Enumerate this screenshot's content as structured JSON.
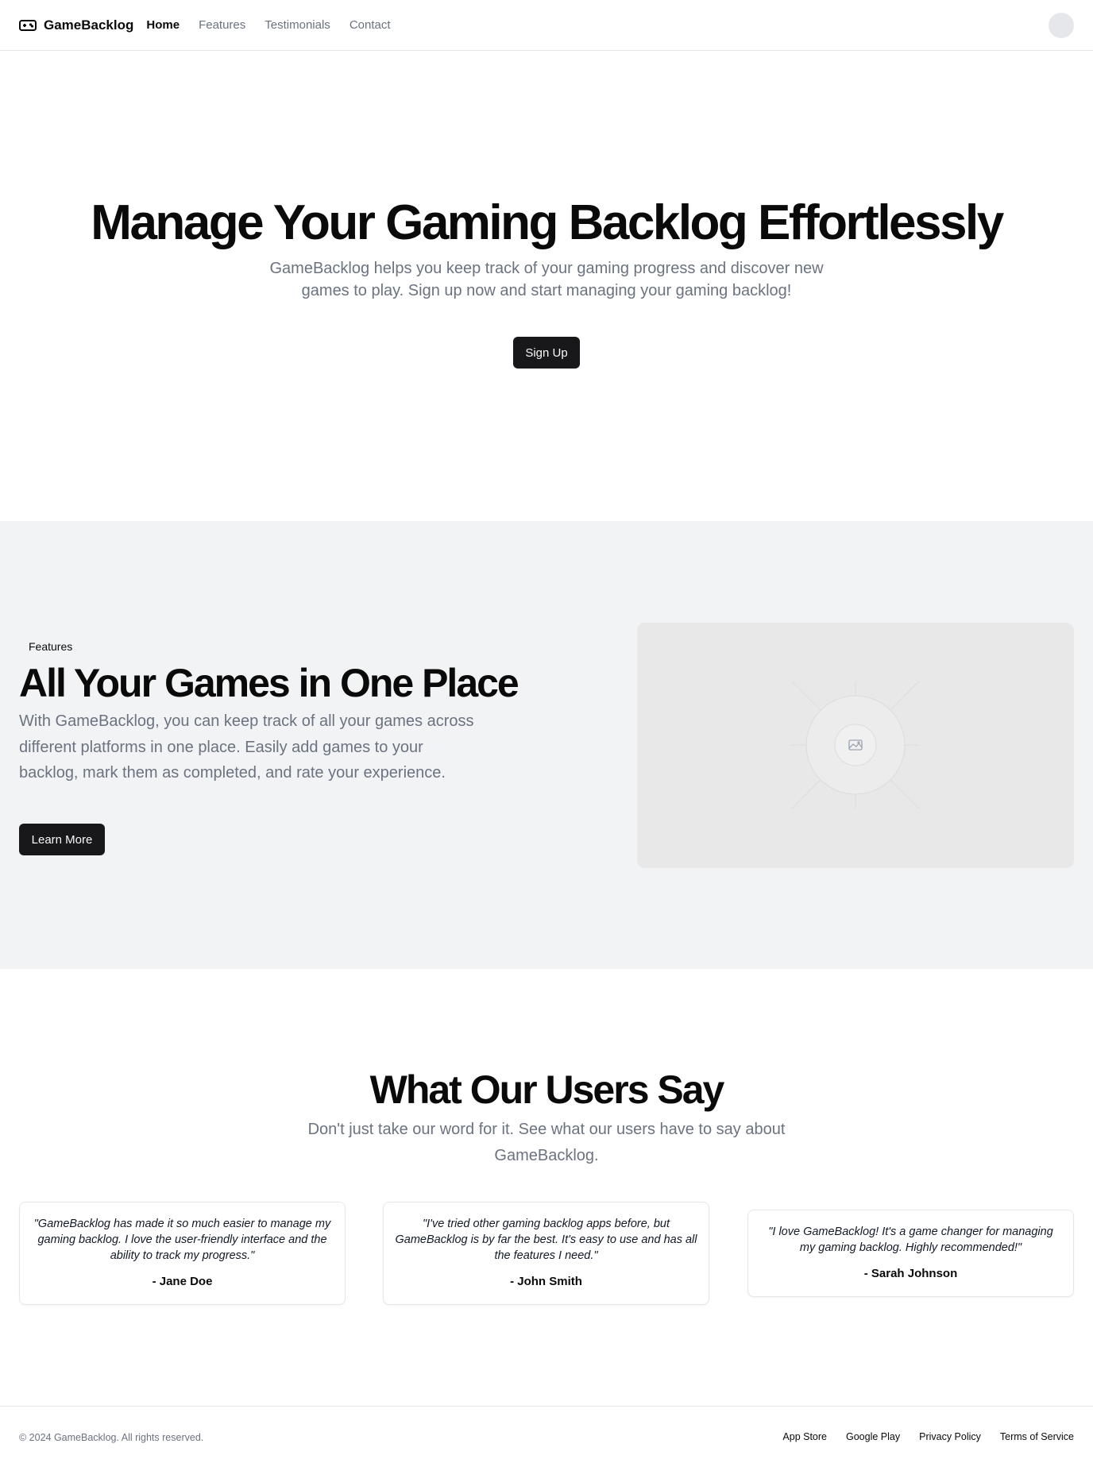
{
  "header": {
    "brand": "GameBacklog",
    "brand_icon": "gamepad-icon",
    "nav": [
      {
        "label": "Home",
        "active": true
      },
      {
        "label": "Features",
        "active": false
      },
      {
        "label": "Testimonials",
        "active": false
      },
      {
        "label": "Contact",
        "active": false
      }
    ]
  },
  "hero": {
    "title": "Manage Your Gaming Backlog Effortlessly",
    "description": "GameBacklog helps you keep track of your gaming progress and discover new games to play. Sign up now and start managing your gaming backlog!",
    "cta": "Sign Up"
  },
  "features": {
    "tag": "Features",
    "title": "All Your Games in One Place",
    "description": "With GameBacklog, you can keep track of all your games across different platforms in one place. Easily add games to your backlog, mark them as completed, and rate your experience.",
    "cta": "Learn More",
    "image_icon": "image-placeholder-icon"
  },
  "testimonials": {
    "title": "What Our Users Say",
    "subtitle": "Don't just take our word for it. See what our users have to say about GameBacklog.",
    "items": [
      {
        "quote": "\"GameBacklog has made it so much easier to manage my gaming backlog. I love the user-friendly interface and the ability to track my progress.\"",
        "author": "- Jane Doe"
      },
      {
        "quote": "\"I've tried other gaming backlog apps before, but GameBacklog is by far the best. It's easy to use and has all the features I need.\"",
        "author": "- John Smith"
      },
      {
        "quote": "\"I love GameBacklog! It's a game changer for managing my gaming backlog. Highly recommended!\"",
        "author": "- Sarah Johnson"
      }
    ]
  },
  "footer": {
    "copyright": "© 2024 GameBacklog. All rights reserved.",
    "links": [
      "App Store",
      "Google Play",
      "Privacy Policy",
      "Terms of Service"
    ]
  },
  "colors": {
    "primary": "#18181b",
    "muted_text": "#6b7280",
    "section_bg": "#f2f3f5",
    "border": "#e5e7eb"
  }
}
